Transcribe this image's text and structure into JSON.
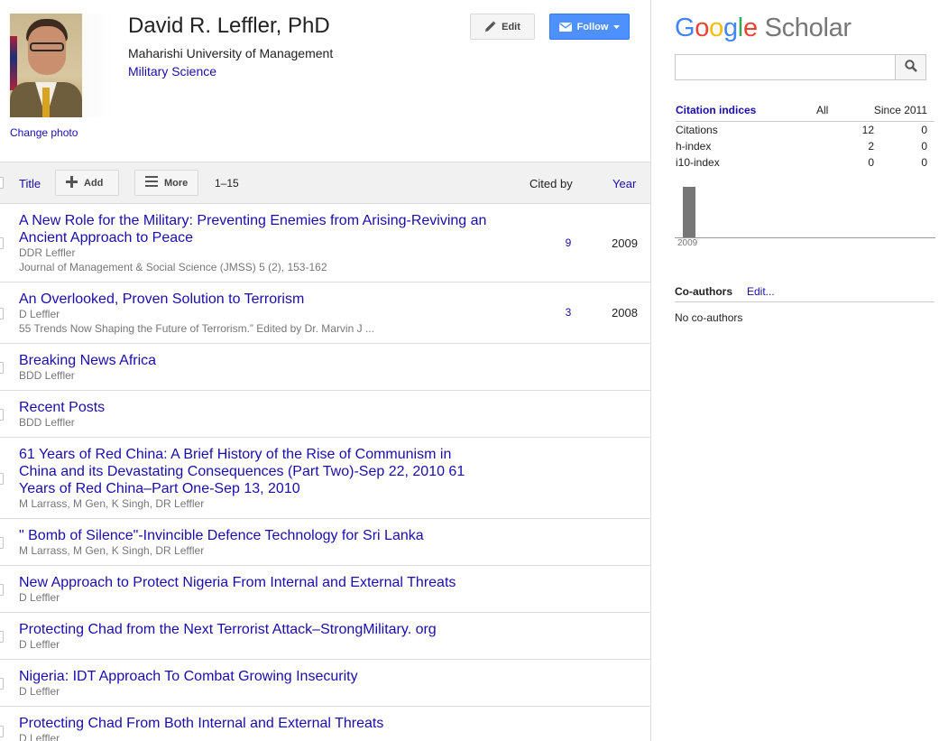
{
  "profile": {
    "name": "David R. Leffler, PhD",
    "affiliation": "Maharishi University of Management",
    "interest": "Military Science",
    "change_photo": "Change photo",
    "edit_label": "Edit",
    "follow_label": "Follow"
  },
  "toolbar": {
    "title": "Title",
    "add_label": "Add",
    "more_label": "More",
    "range": "1–15",
    "cited_by": "Cited by",
    "year": "Year"
  },
  "articles": [
    {
      "title": "A New Role for the Military: Preventing Enemies from Arising-Reviving an Ancient Approach to Peace",
      "authors": "DDR Leffler",
      "venue": "Journal of Management & Social Science (JMSS) 5 (2), 153-162",
      "cited": "9",
      "year": "2009"
    },
    {
      "title": "An Overlooked, Proven Solution to Terrorism",
      "authors": "D Leffler",
      "venue": "55 Trends Now Shaping the Future of Terrorism.” Edited by Dr. Marvin J ...",
      "cited": "3",
      "year": "2008"
    },
    {
      "title": "Breaking News Africa",
      "authors": "BDD Leffler",
      "venue": "",
      "cited": "",
      "year": ""
    },
    {
      "title": "Recent Posts",
      "authors": "BDD Leffler",
      "venue": "",
      "cited": "",
      "year": ""
    },
    {
      "title": "61 Years of Red China: A Brief History of the Rise of Communism in China and its Devastating Consequences (Part Two)-Sep 22, 2010 61 Years of Red China–Part One-Sep 13, 2010",
      "authors": "M Larrass, M Gen, K Singh, DR Leffler",
      "venue": "",
      "cited": "",
      "year": ""
    },
    {
      "title": "\" Bomb of Silence\"-Invincible Defence Technology for Sri Lanka",
      "authors": "M Larrass, M Gen, K Singh, DR Leffler",
      "venue": "",
      "cited": "",
      "year": ""
    },
    {
      "title": "New Approach to Protect Nigeria From Internal and External Threats",
      "authors": "D Leffler",
      "venue": "",
      "cited": "",
      "year": ""
    },
    {
      "title": "Protecting Chad from the Next Terrorist Attack–StrongMilitary. org",
      "authors": "D Leffler",
      "venue": "",
      "cited": "",
      "year": ""
    },
    {
      "title": "Nigeria: IDT Approach To Combat Growing Insecurity",
      "authors": "D Leffler",
      "venue": "",
      "cited": "",
      "year": ""
    },
    {
      "title": "Protecting Chad From Both Internal and External Threats",
      "authors": "D Leffler",
      "venue": "",
      "cited": "",
      "year": ""
    }
  ],
  "scholar": {
    "logo_google": [
      "G",
      "o",
      "o",
      "g",
      "l",
      "e"
    ],
    "logo_scholar": "Scholar"
  },
  "citations": {
    "title": "Citation indices",
    "col_all": "All",
    "col_since": "Since 2011",
    "rows": [
      {
        "label": "Citations",
        "all": "12",
        "since": "0"
      },
      {
        "label": "h-index",
        "all": "2",
        "since": "0"
      },
      {
        "label": "i10-index",
        "all": "0",
        "since": "0"
      }
    ]
  },
  "chart_data": {
    "type": "bar",
    "categories": [
      "2009"
    ],
    "values": [
      12
    ],
    "ylim": [
      0,
      12
    ]
  },
  "coauthors": {
    "title": "Co-authors",
    "edit_label": "Edit...",
    "empty": "No co-authors"
  },
  "colors": {
    "link": "#1a0dab",
    "follow_button": "#4d90fe",
    "chart_bar": "#777777"
  },
  "icons": {
    "edit": "pencil-icon",
    "follow": "envelope-icon",
    "follow_menu": "caret-down-icon",
    "add": "plus-icon",
    "more": "menu-icon",
    "search": "magnifier-icon"
  }
}
